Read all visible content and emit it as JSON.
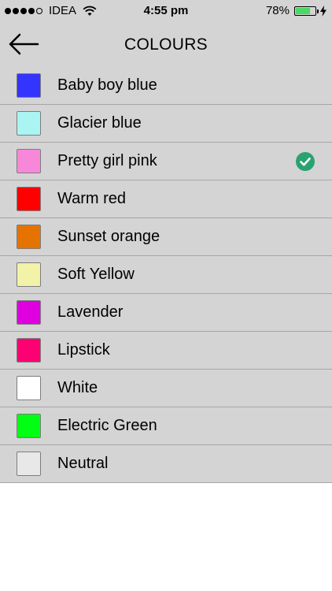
{
  "status": {
    "carrier": "IDEA",
    "time": "4:55 pm",
    "battery_percent": "78%",
    "battery_level": 0.78,
    "signal_bars": 4,
    "signal_total": 5
  },
  "nav": {
    "back_icon": "back-arrow-icon",
    "title": "COLOURS"
  },
  "colours": [
    {
      "label": "Baby boy blue",
      "color": "#3434ff",
      "selected": false
    },
    {
      "label": "Glacier blue",
      "color": "#aaf5f2",
      "selected": false
    },
    {
      "label": "Pretty girl pink",
      "color": "#f788d9",
      "selected": true
    },
    {
      "label": "Warm red",
      "color": "#ff0000",
      "selected": false
    },
    {
      "label": "Sunset orange",
      "color": "#e57300",
      "selected": false
    },
    {
      "label": "Soft Yellow",
      "color": "#f2f2a8",
      "selected": false
    },
    {
      "label": "Lavender",
      "color": "#de00de",
      "selected": false
    },
    {
      "label": "Lipstick",
      "color": "#ff0073",
      "selected": false
    },
    {
      "label": "White",
      "color": "#ffffff",
      "selected": false
    },
    {
      "label": "Electric Green",
      "color": "#00ff12",
      "selected": false
    },
    {
      "label": "Neutral",
      "color": "#e8e8e8",
      "selected": false
    }
  ],
  "theme": {
    "bar_background": "#d4d4d4",
    "check_color": "#2aa26f"
  }
}
